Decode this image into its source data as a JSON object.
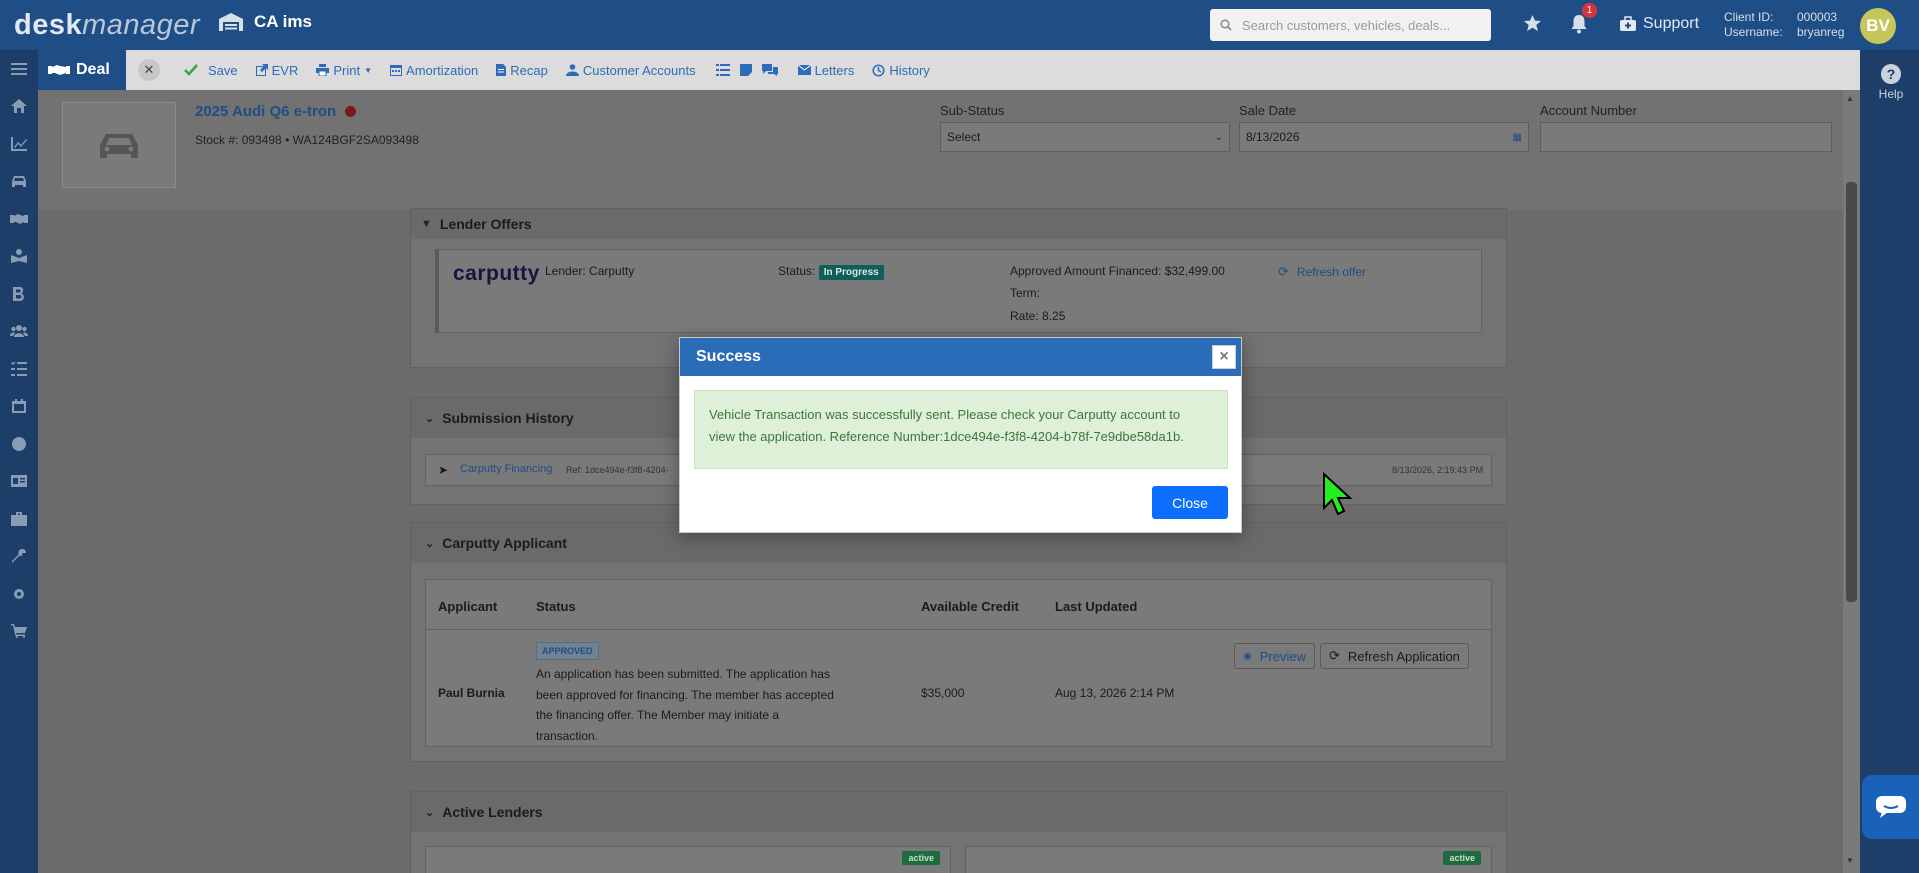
{
  "topbar": {
    "logo_prefix": "desk",
    "logo_suffix": "manager",
    "store_name": "CA ims",
    "search_placeholder": "Search customers, vehicles, deals...",
    "notification_count": "1",
    "support_label": "Support",
    "client_id_label": "Client ID:",
    "client_id_value": "000003",
    "username_label": "Username:",
    "username_value": "bryanreg",
    "avatar_initials": "BV"
  },
  "toolbar": {
    "deal_label": "Deal",
    "save_label": "Save",
    "evr_label": "EVR",
    "print_label": "Print",
    "amortization_label": "Amortization",
    "recap_label": "Recap",
    "customer_accounts_label": "Customer Accounts",
    "letters_label": "Letters",
    "history_label": "History"
  },
  "help_label": "Help",
  "vehicle": {
    "title": "2025 Audi Q6 e-tron",
    "stock_line": "Stock #: 093498  •  WA124BGF2SA093498",
    "substatus_label": "Sub-Status",
    "substatus_value": "Select",
    "sale_date_label": "Sale Date",
    "sale_date_value": "8/13/2026",
    "account_number_label": "Account Number",
    "account_number_value": ""
  },
  "lender_offers": {
    "title": "Lender Offers",
    "logo_text": "carputty",
    "lender": "Lender: Carputty",
    "status_label": "Status:",
    "status_value": "In Progress",
    "approved_amount": "Approved Amount Financed: $32,499.00",
    "term": "Term:",
    "rate": "Rate: 8.25",
    "refresh_label": "Refresh offer"
  },
  "submission_history": {
    "title": "Submission History",
    "item_name": "Carputty Financing",
    "item_ref": "Ref: 1dce494e-f3f8-4204-",
    "item_time": "8/13/2026, 2:19:43 PM"
  },
  "applicant": {
    "title": "Carputty Applicant",
    "columns": [
      "Applicant",
      "Status",
      "Available Credit",
      "Last Updated"
    ],
    "name": "Paul Burnia",
    "badge": "APPROVED",
    "status_text_1": "An application has been submitted. The application has",
    "status_text_2": "been approved for financing. The member has accepted",
    "status_text_3": "the financing offer. The Member may initiate a",
    "status_text_4": "transaction.",
    "available_credit": "$35,000",
    "last_updated": "Aug 13, 2026 2:14 PM",
    "preview_label": "Preview",
    "refresh_app_label": "Refresh Application"
  },
  "active_lenders": {
    "title": "Active Lenders",
    "badge_1": "active",
    "badge_2": "active"
  },
  "modal": {
    "title": "Success",
    "close_x": "×",
    "message_1": "Vehicle Transaction was successfully sent. Please check your Carputty account to",
    "message_2": "view the application. Reference Number:1dce494e-f3f8-4204-b78f-7e9dbe58da1b.",
    "close_label": "Close"
  },
  "colors": {
    "brand_blue": "#1f4e86",
    "modal_header": "#2b6cb8",
    "primary_button": "#0d6efd",
    "success_bg": "#dff0d8",
    "success_text": "#3c763d"
  }
}
